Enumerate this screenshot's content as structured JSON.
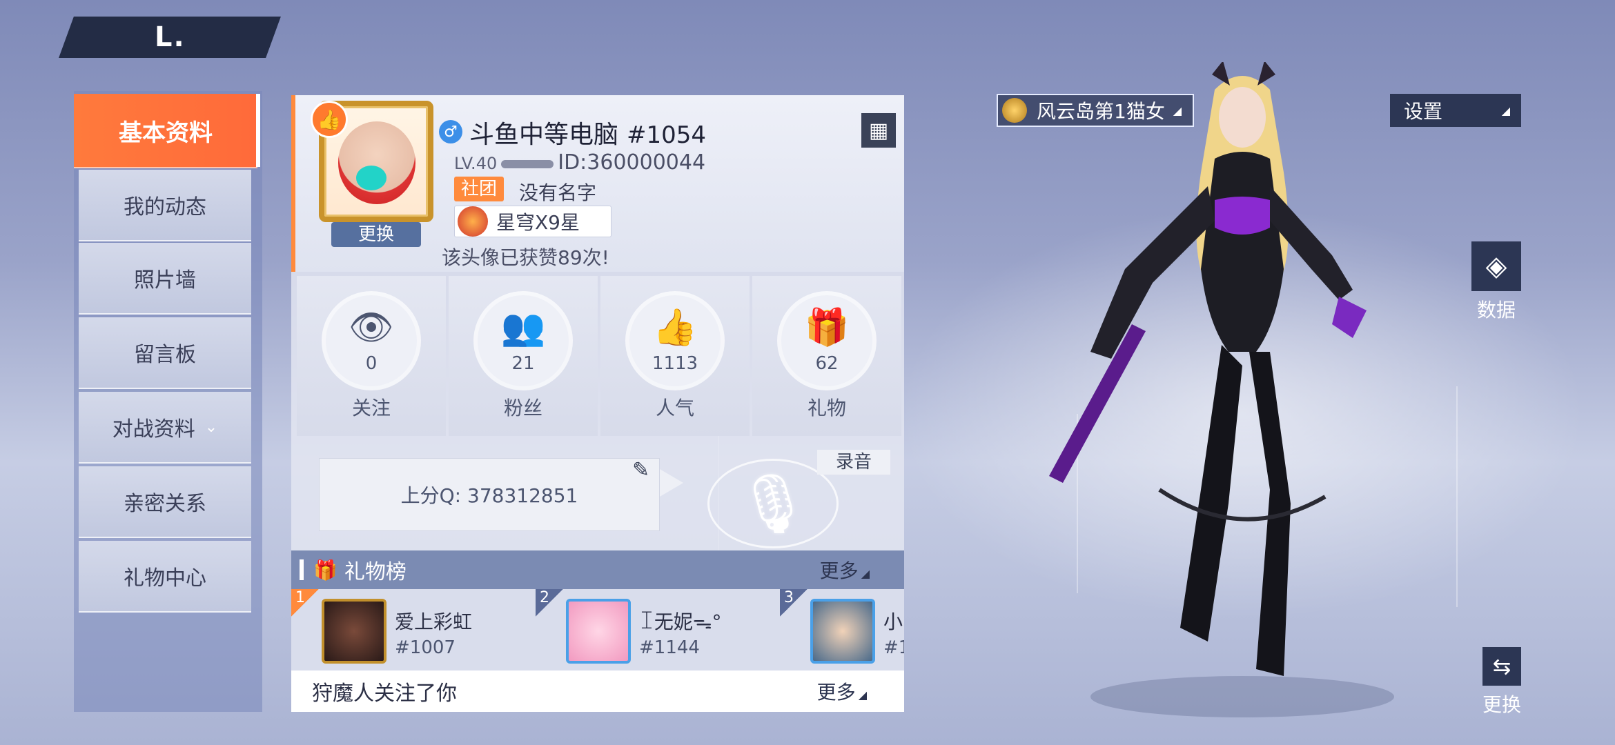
{
  "header": {
    "back_glyph": "L."
  },
  "sidebar": {
    "items": [
      {
        "label": "基本资料"
      },
      {
        "label": "我的动态"
      },
      {
        "label": "照片墙"
      },
      {
        "label": "留言板"
      },
      {
        "label": "对战资料"
      },
      {
        "label": "亲密关系"
      },
      {
        "label": "礼物中心"
      }
    ]
  },
  "profile": {
    "gender_icon": "♂",
    "nickname": "斗鱼中等电脑",
    "tag": "#1054",
    "level_prefix": "LV.40",
    "id_text": "ID:360000044",
    "club_label": "社团",
    "club_name": "没有名字",
    "title_name": "星穹X9星",
    "change_label": "更换",
    "likes_note": "该头像已获赞89次!"
  },
  "stats": [
    {
      "value": "0",
      "label": "关注",
      "icon": "eye-icon"
    },
    {
      "value": "21",
      "label": "粉丝",
      "icon": "fans-icon"
    },
    {
      "value": "1113",
      "label": "人气",
      "icon": "thumbs-up-icon"
    },
    {
      "value": "62",
      "label": "礼物",
      "icon": "gift-icon"
    }
  ],
  "signature": {
    "text": "上分Q: 378312851",
    "record_label": "录音"
  },
  "gift_board": {
    "title": "礼物榜",
    "more_label": "更多",
    "items": [
      {
        "rank": "1",
        "name": "爱上彩虹",
        "tag": "#1007"
      },
      {
        "rank": "2",
        "name": "ꀤ无妮ᯓ°",
        "tag": "#1144"
      },
      {
        "rank": "3",
        "name": "小",
        "tag": "#1"
      }
    ]
  },
  "notice": {
    "text": "狩魔人关注了你",
    "more_label": "更多"
  },
  "right": {
    "title_badge": "风云岛第1猫女",
    "settings_label": "设置",
    "data_label": "数据",
    "swap_label": "更换"
  },
  "colors": {
    "accent": "#ff7a3c",
    "panel_dark": "#2c3654",
    "gift_header": "#7b8bb3"
  }
}
